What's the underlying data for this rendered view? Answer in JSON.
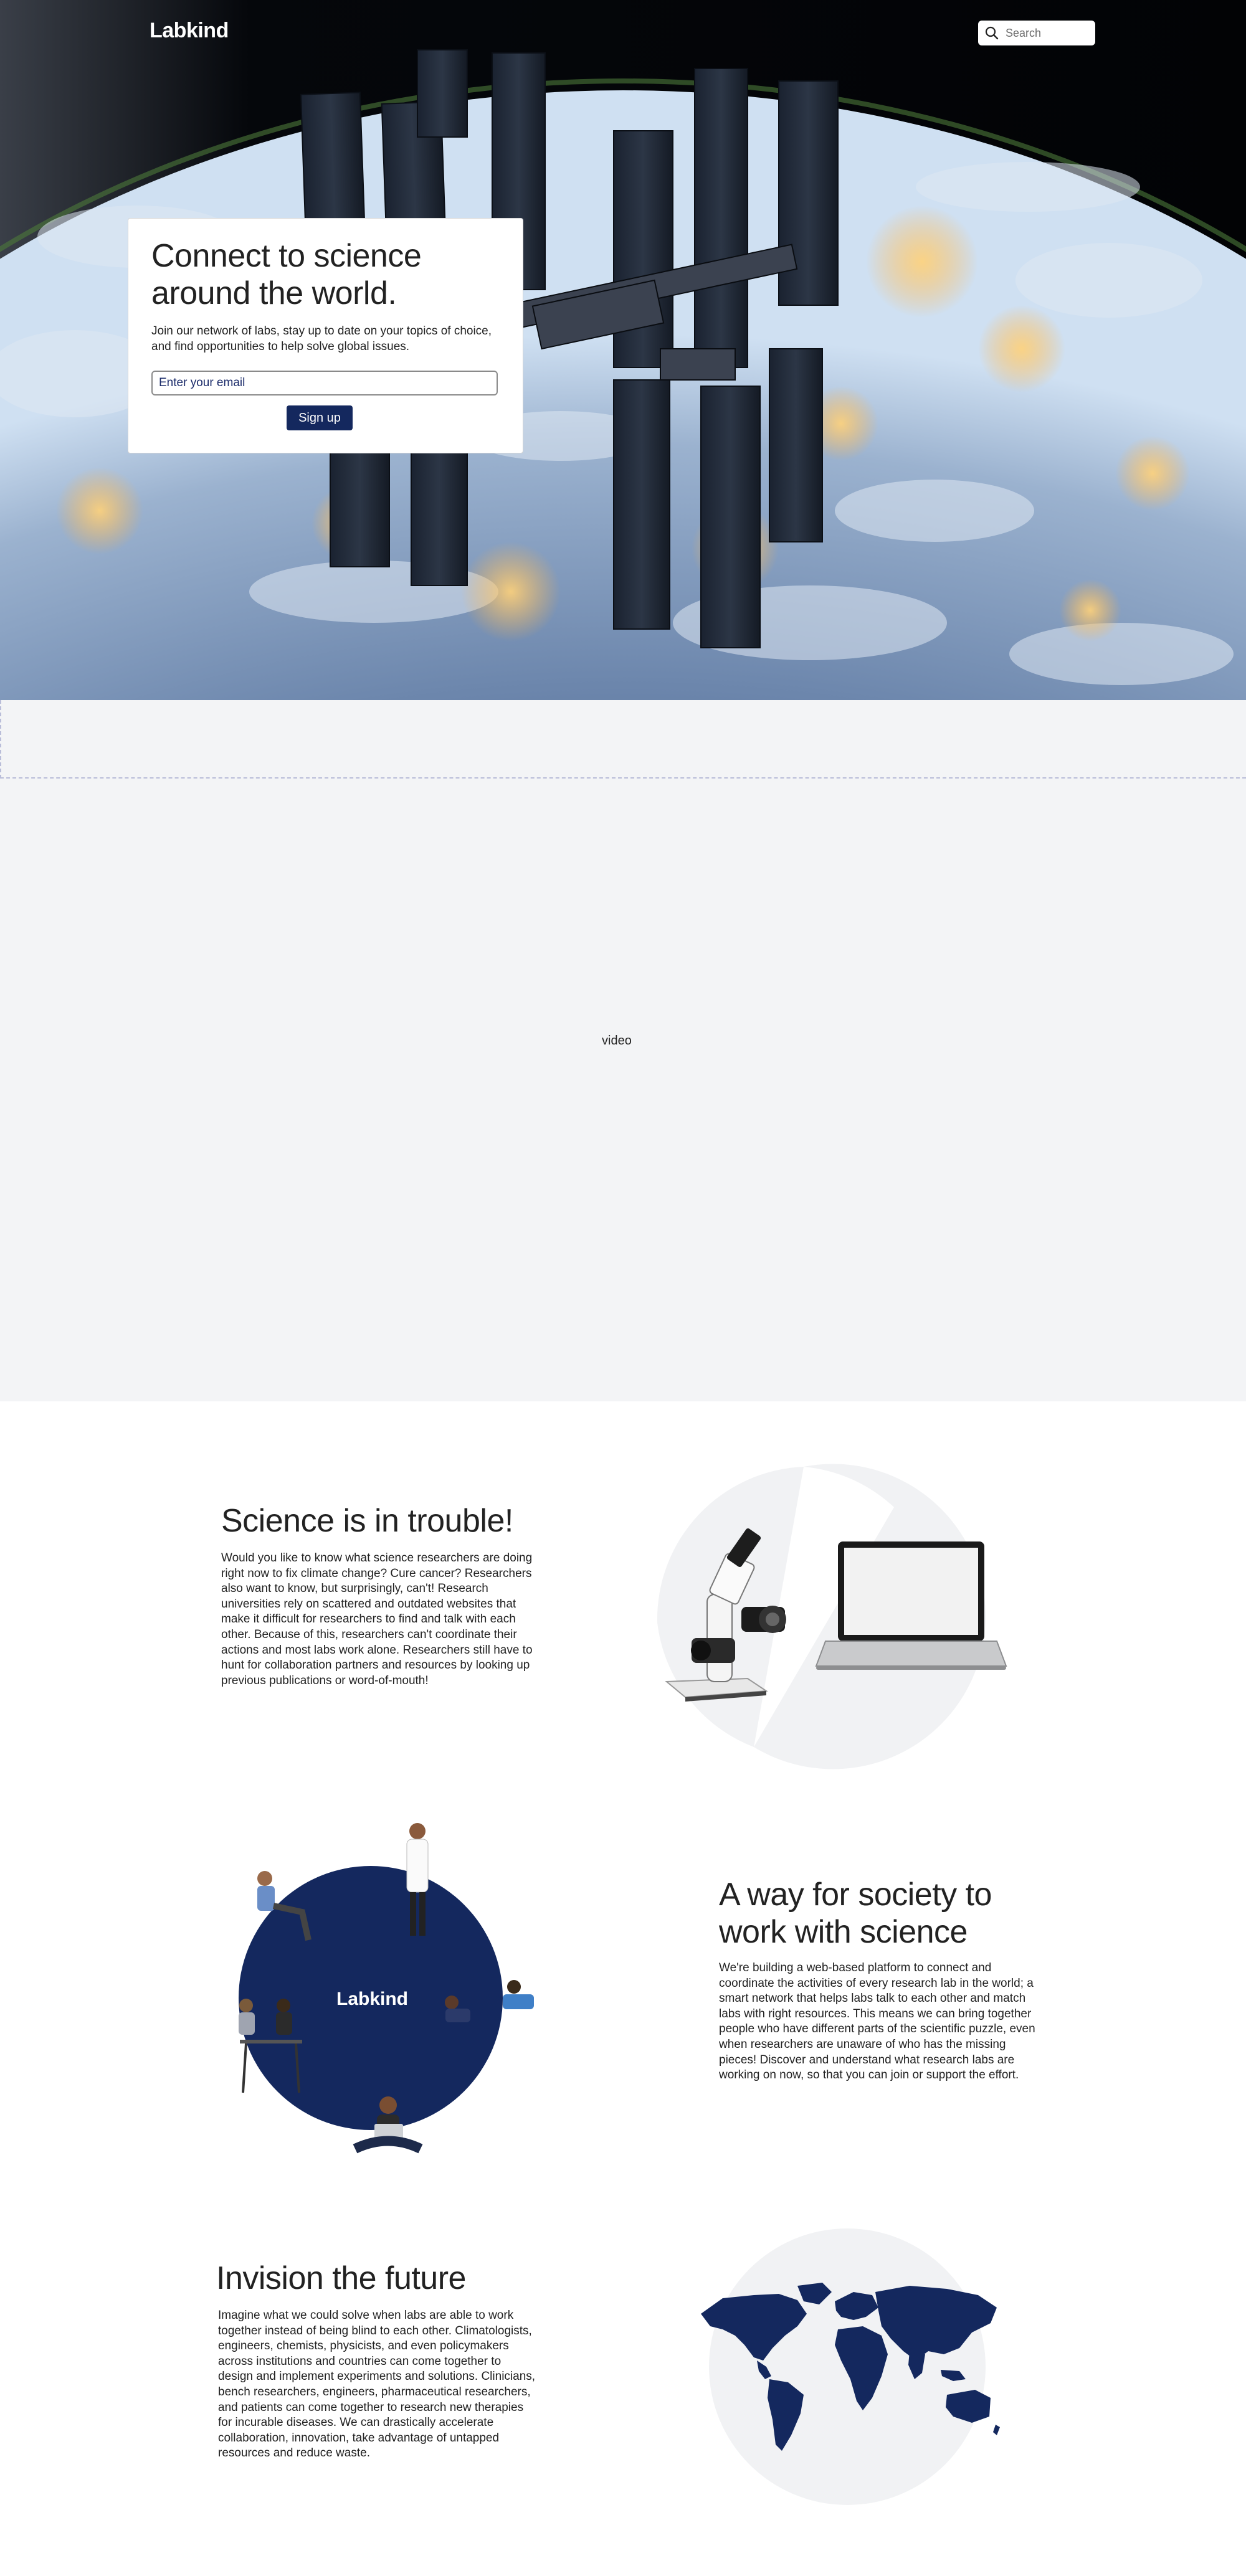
{
  "header": {
    "logo": "Labkind",
    "search_placeholder": "Search"
  },
  "hero": {
    "title": "Connect to science around the world.",
    "subtitle": "Join our network of labs, stay up to date on your topics of choice, and find opportunities to help solve global issues.",
    "email_placeholder": "Enter your email",
    "signup_label": "Sign up"
  },
  "video": {
    "label": "video"
  },
  "sections": [
    {
      "title": "Science is in trouble!",
      "body": "Would you like to know what science researchers are doing right now to fix climate change? Cure cancer? Researchers also want to know, but surprisingly, can't! Research universities rely on scattered and outdated websites that make it difficult for researchers to find and talk with each other. Because of this, researchers can't coordinate their actions and most labs work alone. Researchers still have to hunt for collaboration partners and resources by looking up previous publications or word-of-mouth!"
    },
    {
      "title": "A way for society to work with science",
      "body": "We're building a web-based platform to connect and coordinate the activities of every research lab in the world; a smart network that helps labs talk to each other and match labs with right resources. This means we can bring together people who have different parts of the scientific puzzle, even when researchers are unaware of who has the missing pieces! Discover and understand what research labs are working on now, so that you can join or support the effort.",
      "circle_label": "Labkind"
    },
    {
      "title": "Invision the future",
      "body": "Imagine what we could solve when labs are able to work together instead of being blind to each other. Climatologists, engineers, chemists, physicists, and even policymakers across institutions and countries can come together to design and implement experiments and solutions. Clinicians, bench researchers, engineers, pharmaceutical researchers, and patients can come together to research new therapies for incurable diseases. We can drastically accelerate collaboration, innovation, take advantage of untapped resources and reduce waste."
    }
  ],
  "colors": {
    "navy": "#14285e",
    "light_gray": "#f3f4f6"
  }
}
